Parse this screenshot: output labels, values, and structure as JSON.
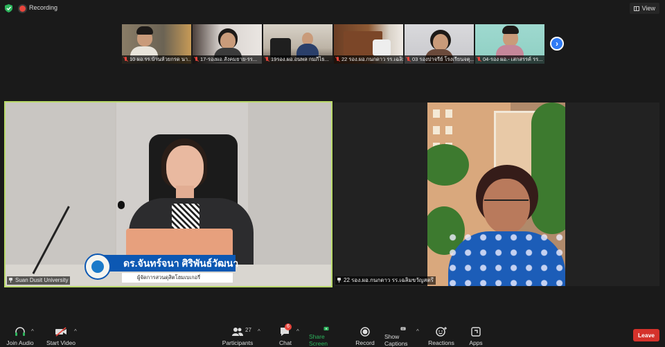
{
  "topbar": {
    "recording_label": "Recording",
    "view_label": "View"
  },
  "thumbnails": [
    {
      "label": "10 ผอ.รร.บ้านห้วยกรด นา..."
    },
    {
      "label": "17-รองผอ.สังคมยาย-รร..."
    },
    {
      "label": "19รอง.ผอ.อนพล  กมภีไธ..."
    },
    {
      "label": "22 รอง.ผอ.กนกดาว รร.เฉลิมข..."
    },
    {
      "label": "03 รองปาจรีย์ โรงเรียนจตุ..."
    },
    {
      "label": "04-รอง ผอ.- เสกสรรค์ รร..."
    }
  ],
  "main_video": {
    "tile_label": "Suan Dusit University",
    "nameplate_name": "ดร.จันทร์จนา ศิริพันธ์วัฒนา",
    "nameplate_title": "ผู้จัดการสวนดุสิตโฮมเบเกอรี่"
  },
  "side_video": {
    "tile_label": "22 รอง.ผอ.กนกดาว รร.เฉลิมขวัญสตรี"
  },
  "toolbar": {
    "join_audio": "Join Audio",
    "start_video": "Start Video",
    "participants": "Participants",
    "participants_count": "27",
    "chat": "Chat",
    "chat_badge": "6",
    "share_screen": "Share Screen",
    "record": "Record",
    "show_captions": "Show Captions",
    "reactions": "Reactions",
    "apps": "Apps",
    "leave": "Leave"
  },
  "colors": {
    "active_speaker_border": "#b9d96a",
    "share_screen_green": "#2db55d",
    "leave_red": "#d5322b",
    "next_button_blue": "#2f7bf6"
  }
}
